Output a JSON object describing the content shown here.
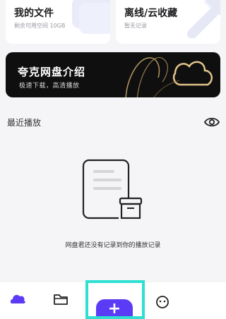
{
  "cards": {
    "files": {
      "title": "我的文件",
      "subtitle": "剩余可用空间 10GB"
    },
    "offline": {
      "title": "离线/云收藏",
      "subtitle": "暂无记录"
    }
  },
  "banner": {
    "title": "夸克网盘介绍",
    "subtitle": "极速下载，高清播放"
  },
  "recent": {
    "title": "最近播放",
    "empty_text": "网盘君还没有记录到你的播放记录"
  },
  "tabbar": {
    "add_label": "+"
  },
  "colors": {
    "accent": "#5c3bf6",
    "highlight": "#2fe0d2",
    "banner_bg": "#0f0f0f"
  },
  "icons": [
    "cloud-home-icon",
    "folder-icon",
    "plus-icon",
    "eye-icon",
    "document-box-icon",
    "avatar-icon"
  ]
}
